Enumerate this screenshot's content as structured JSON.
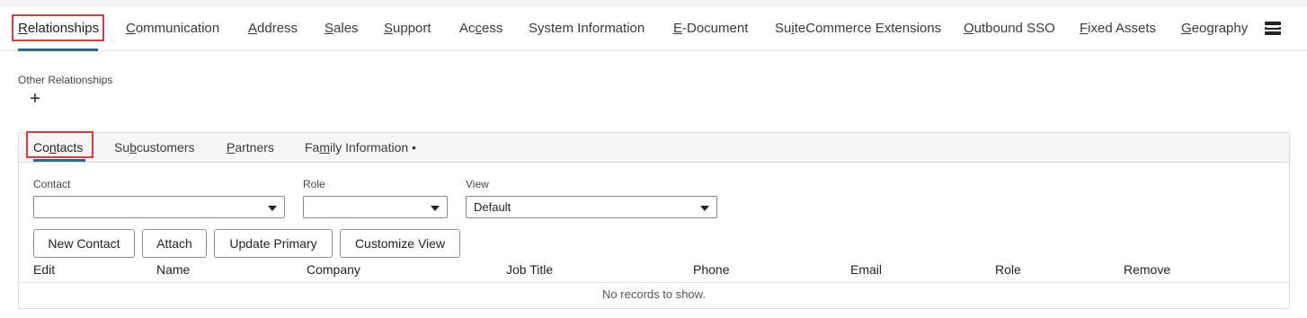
{
  "main_tabs": [
    {
      "pre": "",
      "ul": "R",
      "post": "elationships"
    },
    {
      "pre": "",
      "ul": "C",
      "post": "ommunication"
    },
    {
      "pre": "",
      "ul": "A",
      "post": "ddress"
    },
    {
      "pre": "",
      "ul": "S",
      "post": "ales"
    },
    {
      "pre": "",
      "ul": "S",
      "post": "upport"
    },
    {
      "pre": "Ac",
      "ul": "c",
      "post": "ess"
    },
    {
      "pre": "System Information",
      "ul": "",
      "post": ""
    },
    {
      "pre": "",
      "ul": "E",
      "post": "-Document"
    },
    {
      "pre": "Su",
      "ul": "i",
      "post": "teCommerce Extensions"
    },
    {
      "pre": "",
      "ul": "O",
      "post": "utbound SSO"
    },
    {
      "pre": "",
      "ul": "F",
      "post": "ixed Assets"
    },
    {
      "pre": "",
      "ul": "G",
      "post": "eography"
    }
  ],
  "other_relationships": {
    "label": "Other Relationships",
    "add_symbol": "+"
  },
  "sub_tabs": [
    {
      "pre": "Co",
      "ul": "n",
      "post": "tacts"
    },
    {
      "pre": "Su",
      "ul": "b",
      "post": "customers"
    },
    {
      "pre": "",
      "ul": "P",
      "post": "artners"
    },
    {
      "pre": "Fa",
      "ul": "m",
      "post": "ily Information •"
    }
  ],
  "filters": {
    "contact": {
      "label": "Contact",
      "value": ""
    },
    "role": {
      "label": "Role",
      "value": ""
    },
    "view": {
      "label": "View",
      "value": "Default"
    }
  },
  "buttons": {
    "new_contact": "New Contact",
    "attach": "Attach",
    "update_primary": "Update Primary",
    "customize_view": "Customize View"
  },
  "table": {
    "columns": [
      "Edit",
      "Name",
      "Company",
      "Job Title",
      "Phone",
      "Email",
      "Role",
      "Remove"
    ],
    "empty_message": "No records to show."
  },
  "colors": {
    "highlight_box": "#e0383e",
    "active_tab_underline": "#2a6a8a"
  },
  "icons": {
    "menu": "menu-icon",
    "add": "plus-icon",
    "dropdown": "chevron-down-icon"
  }
}
